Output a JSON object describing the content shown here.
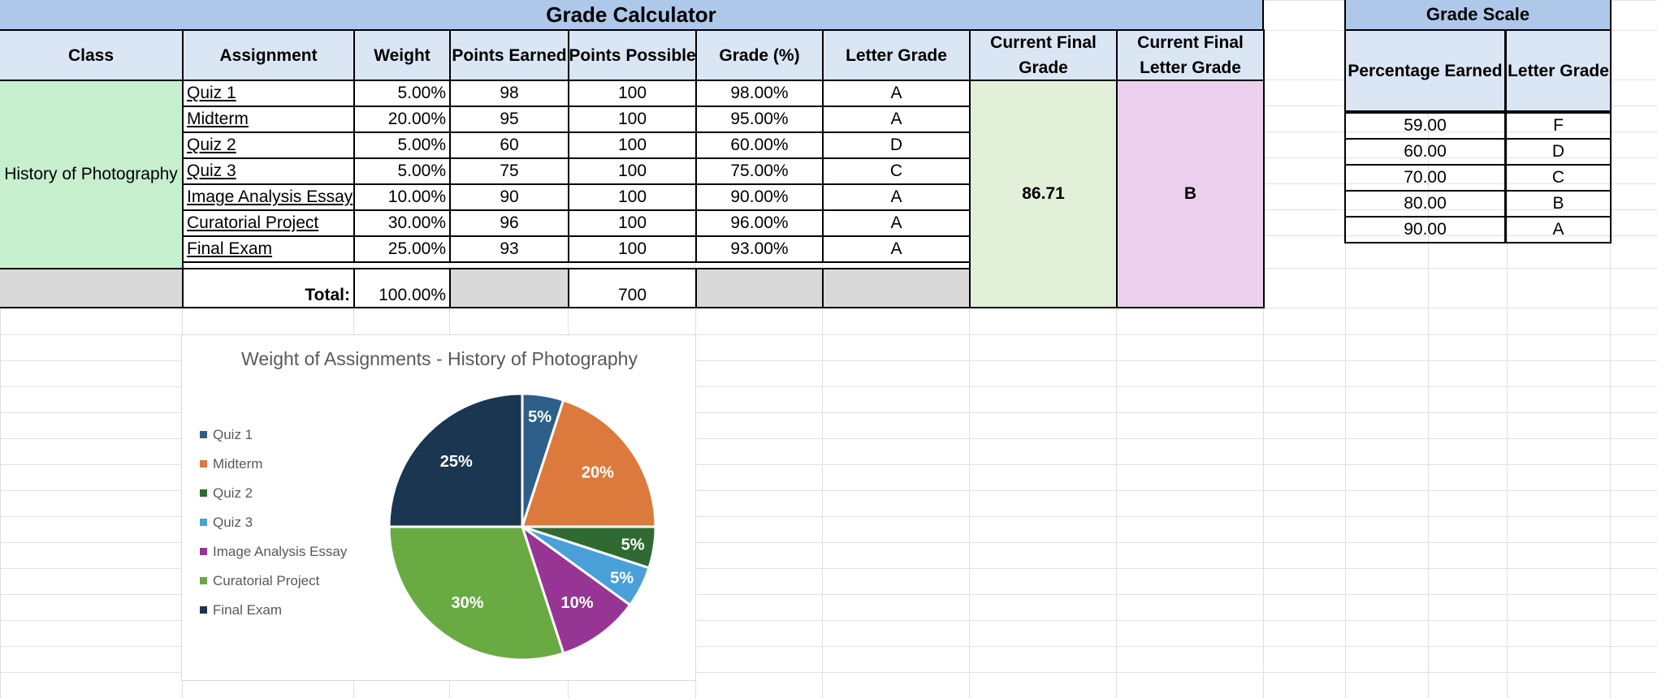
{
  "calculator": {
    "title": "Grade Calculator",
    "headers": {
      "class": "Class",
      "assignment": "Assignment",
      "weight": "Weight",
      "earned": "Points Earned",
      "possible": "Points Possible",
      "grade": "Grade (%)",
      "letter": "Letter Grade",
      "final_grade": "Current Final Grade",
      "final_letter": "Current Final Letter Grade"
    },
    "class_name": "History of Photography",
    "rows": [
      {
        "assignment": "Quiz 1",
        "weight": "5.00%",
        "earned": "98",
        "possible": "100",
        "grade": "98.00%",
        "letter": "A"
      },
      {
        "assignment": "Midterm",
        "weight": "20.00%",
        "earned": "95",
        "possible": "100",
        "grade": "95.00%",
        "letter": "A"
      },
      {
        "assignment": "Quiz 2",
        "weight": "5.00%",
        "earned": "60",
        "possible": "100",
        "grade": "60.00%",
        "letter": "D"
      },
      {
        "assignment": "Quiz 3",
        "weight": "5.00%",
        "earned": "75",
        "possible": "100",
        "grade": "75.00%",
        "letter": "C"
      },
      {
        "assignment": "Image Analysis Essay",
        "weight": "10.00%",
        "earned": "90",
        "possible": "100",
        "grade": "90.00%",
        "letter": "A"
      },
      {
        "assignment": "Curatorial Project",
        "weight": "30.00%",
        "earned": "96",
        "possible": "100",
        "grade": "96.00%",
        "letter": "A"
      },
      {
        "assignment": "Final Exam",
        "weight": "25.00%",
        "earned": "93",
        "possible": "100",
        "grade": "93.00%",
        "letter": "A"
      }
    ],
    "total_label": "Total:",
    "total_weight": "100.00%",
    "total_possible": "700",
    "final_grade": "86.71",
    "final_letter": "B"
  },
  "scale": {
    "title": "Grade Scale",
    "headers": {
      "percent": "Percentage Earned",
      "letter": "Letter Grade"
    },
    "rows": [
      {
        "percent": "59.00",
        "letter": "F"
      },
      {
        "percent": "60.00",
        "letter": "D"
      },
      {
        "percent": "70.00",
        "letter": "C"
      },
      {
        "percent": "80.00",
        "letter": "B"
      },
      {
        "percent": "90.00",
        "letter": "A"
      }
    ]
  },
  "colors": {
    "title_fill": "#aec8e9",
    "header_fill": "#dae6f3",
    "class_fill": "#c6efce",
    "final_grade_fill": "#e2f0d9",
    "final_letter_fill": "#eccfed",
    "total_fill": "#d9d9d9",
    "gridline": "#e0e0e0"
  },
  "chart_data": {
    "type": "pie",
    "title": "Weight of Assignments - History of Photography",
    "categories": [
      "Quiz 1",
      "Midterm",
      "Quiz 2",
      "Quiz 3",
      "Image Analysis Essay",
      "Curatorial Project",
      "Final Exam"
    ],
    "values": [
      5,
      20,
      5,
      5,
      10,
      30,
      25
    ],
    "labels": [
      "5%",
      "20%",
      "5%",
      "5%",
      "10%",
      "30%",
      "25%"
    ],
    "colors": [
      "#2e5f8a",
      "#dc7a3e",
      "#2f6a32",
      "#4aa0d8",
      "#973595",
      "#6aaa43",
      "#1a3650"
    ],
    "legend": "left"
  }
}
